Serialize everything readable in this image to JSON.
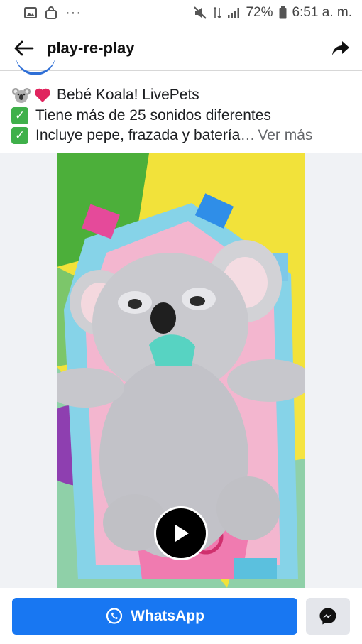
{
  "status_bar": {
    "battery": "72%",
    "time": "6:51 a. m.",
    "dots": "···"
  },
  "app_bar": {
    "title": "play-re-play"
  },
  "post": {
    "line1": "Bebé Koala! LivePets",
    "line2": "Tiene más de 25 sonidos diferentes",
    "line3": "Incluye pepe, frazada y batería",
    "ellipsis": "…",
    "see_more": "Ver más"
  },
  "cta": {
    "whatsapp_label": "WhatsApp"
  },
  "colors": {
    "accent": "#1877f2",
    "check": "#3fb04a",
    "heart": "#e0245e"
  }
}
